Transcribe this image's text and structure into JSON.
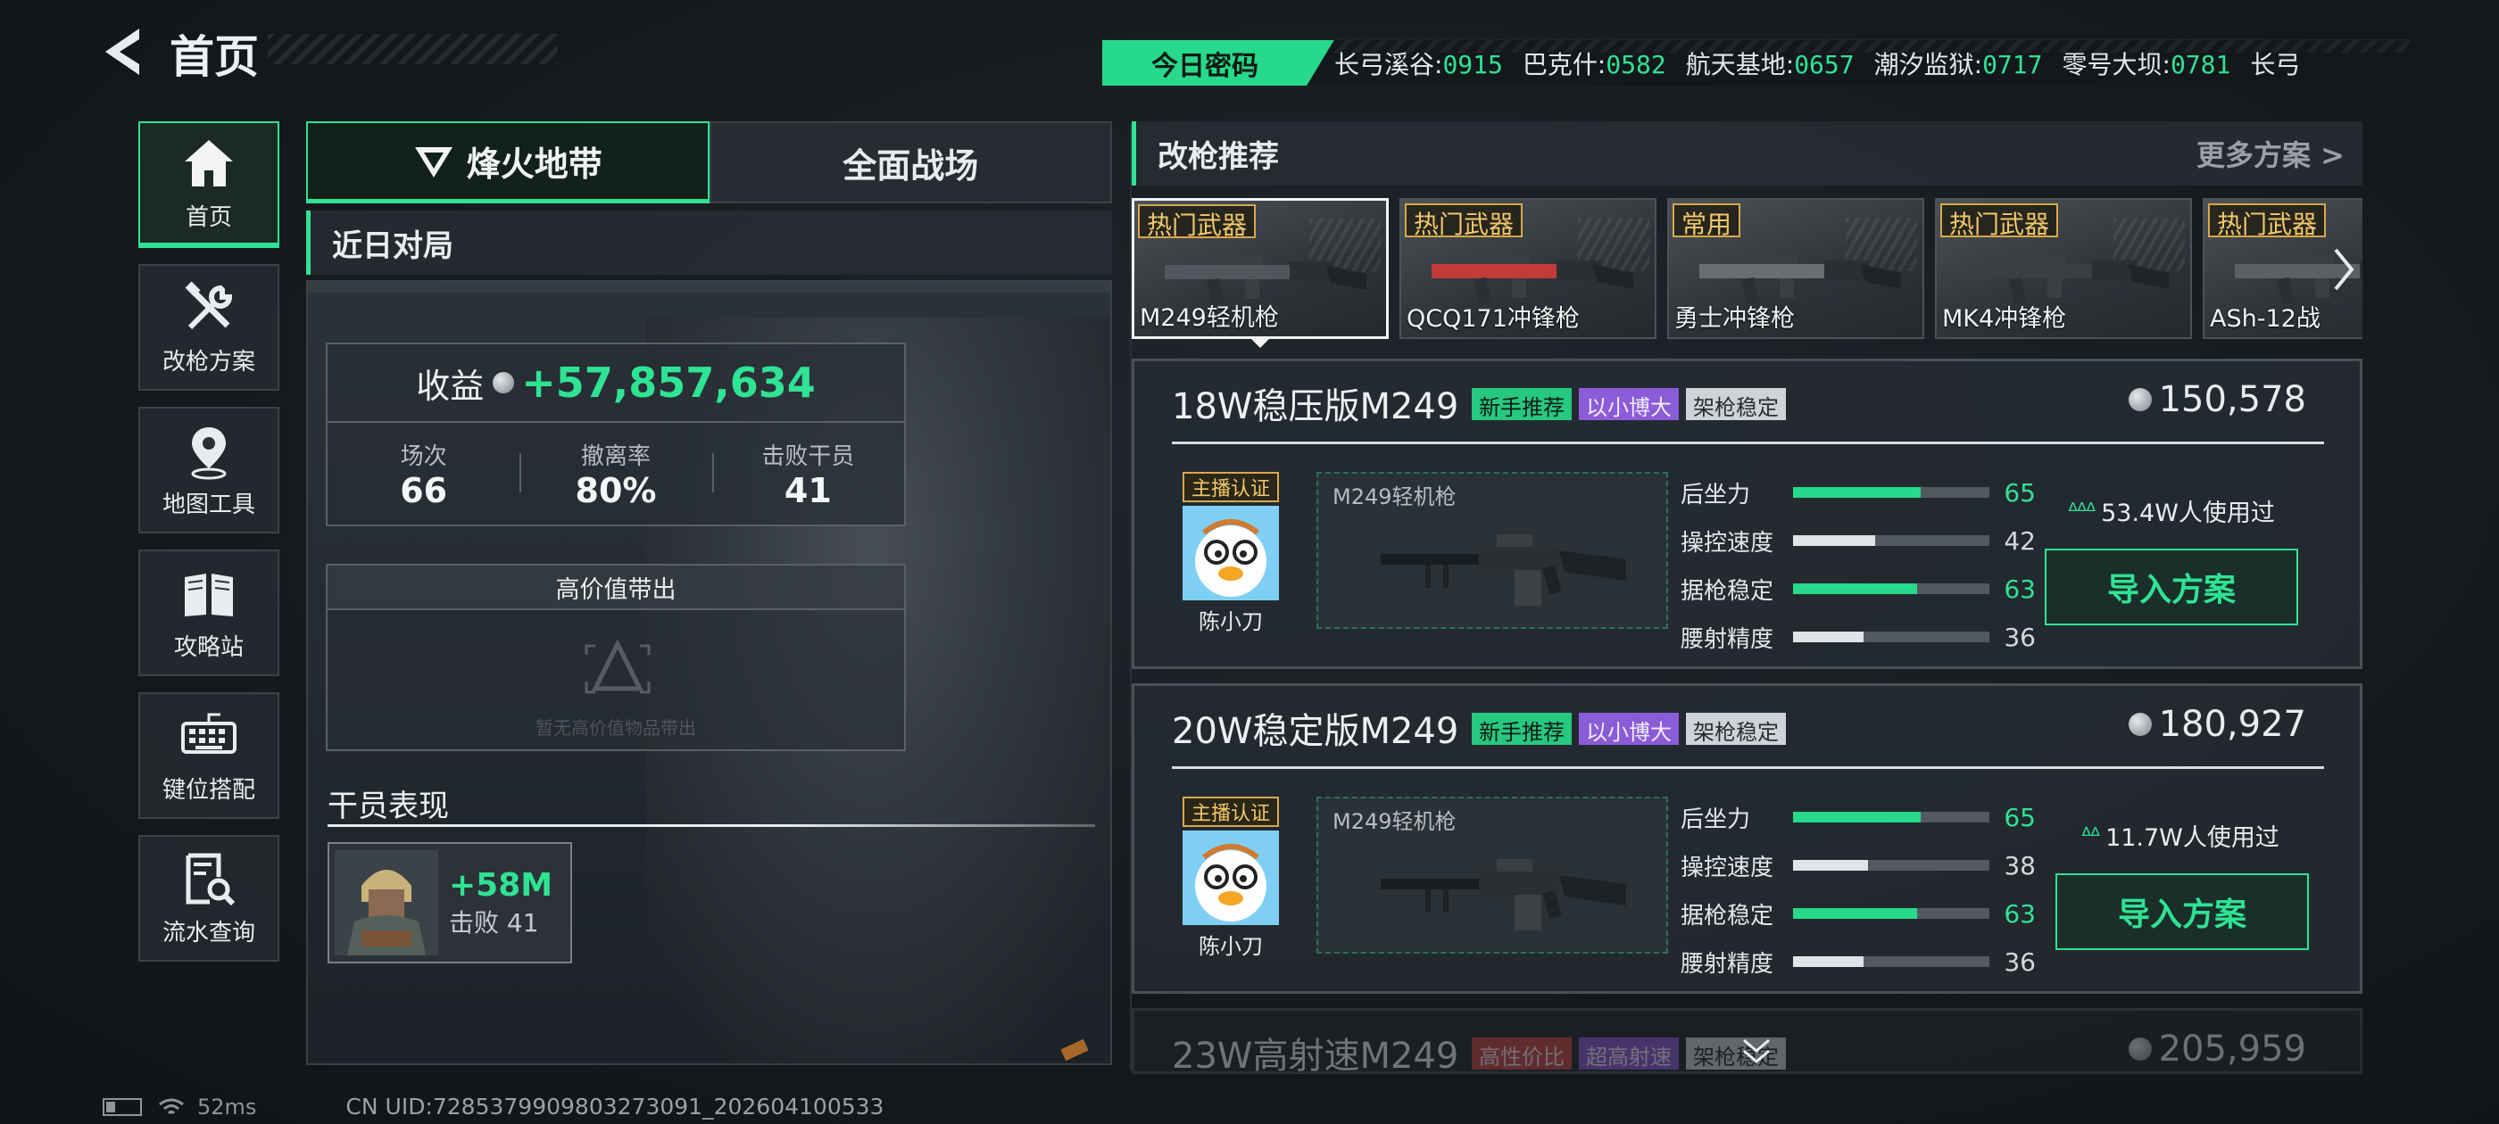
{
  "header": {
    "title": "首页",
    "code_label": "今日密码",
    "codes": [
      {
        "name": "长弓溪谷:",
        "code": "0915"
      },
      {
        "name": "巴克什:",
        "code": "0582"
      },
      {
        "name": "航天基地:",
        "code": "0657"
      },
      {
        "name": "潮汐监狱:",
        "code": "0717"
      },
      {
        "name": "零号大坝:",
        "code": "0781"
      },
      {
        "name": "长弓",
        "code": ""
      }
    ]
  },
  "nav": {
    "items": [
      {
        "label": "首页",
        "icon": "home-icon"
      },
      {
        "label": "改枪方案",
        "icon": "wrench-icon"
      },
      {
        "label": "地图工具",
        "icon": "map-pin-icon"
      },
      {
        "label": "攻略站",
        "icon": "book-icon"
      },
      {
        "label": "键位搭配",
        "icon": "keyboard-icon"
      },
      {
        "label": "流水查询",
        "icon": "search-document-icon"
      }
    ]
  },
  "mid": {
    "tabs": [
      "烽火地带",
      "全面战场"
    ],
    "recent_title": "近日对局",
    "earn_label": "收益",
    "earn_value": "+57,857,634",
    "stats": [
      {
        "label": "场次",
        "value": "66"
      },
      {
        "label": "撤离率",
        "value": "80%"
      },
      {
        "label": "击败干员",
        "value": "41"
      }
    ],
    "high_value_title": "高价值带出",
    "high_value_empty": "暂无高价值物品带出",
    "perf_title": "干员表现",
    "perf_value": "+58M",
    "perf_sub": "击败 41"
  },
  "right": {
    "title": "改枪推荐",
    "more": "更多方案 >",
    "weapons": [
      {
        "tag": "热门武器",
        "name": "M249轻机枪"
      },
      {
        "tag": "热门武器",
        "name": "QCQ171冲锋枪"
      },
      {
        "tag": "常用",
        "name": "勇士冲锋枪"
      },
      {
        "tag": "热门武器",
        "name": "MK4冲锋枪"
      },
      {
        "tag": "热门武器",
        "name": "ASh-12战"
      }
    ],
    "plans": [
      {
        "title": "18W稳压版M249",
        "tags": [
          "新手推荐",
          "以小博大",
          "架枪稳定"
        ],
        "price": "150,578",
        "anchor_tag": "主播认证",
        "anchor_name": "陈小刀",
        "gun": "M249轻机枪",
        "attrs": [
          {
            "label": "后坐力",
            "value": "65",
            "pct": 0.65,
            "green": true
          },
          {
            "label": "操控速度",
            "value": "42",
            "pct": 0.42,
            "green": false
          },
          {
            "label": "据枪稳定",
            "value": "63",
            "pct": 0.63,
            "green": true
          },
          {
            "label": "腰射精度",
            "value": "36",
            "pct": 0.36,
            "green": false
          }
        ],
        "usage": "53.4W人使用过",
        "flames": "ᐞᐞᐞ",
        "import": "导入方案"
      },
      {
        "title": "20W稳定版M249",
        "tags": [
          "新手推荐",
          "以小博大",
          "架枪稳定"
        ],
        "price": "180,927",
        "anchor_tag": "主播认证",
        "anchor_name": "陈小刀",
        "gun": "M249轻机枪",
        "attrs": [
          {
            "label": "后坐力",
            "value": "65",
            "pct": 0.65,
            "green": true
          },
          {
            "label": "操控速度",
            "value": "38",
            "pct": 0.38,
            "green": false
          },
          {
            "label": "据枪稳定",
            "value": "63",
            "pct": 0.63,
            "green": true
          },
          {
            "label": "腰射精度",
            "value": "36",
            "pct": 0.36,
            "green": false
          }
        ],
        "usage": "11.7W人使用过",
        "flames": "ᐞᐞ",
        "import": "导入方案"
      },
      {
        "title": "23W高射速M249",
        "tags": [
          "高性价比",
          "超高射速",
          "架枪稳定"
        ],
        "price": "205,959"
      }
    ]
  },
  "footer": {
    "ping": "52ms",
    "uid": "CN UID:7285379909803273091_202604100533"
  },
  "colors": {
    "accent": "#2fe394",
    "tag_gold": "#d8a84a"
  }
}
